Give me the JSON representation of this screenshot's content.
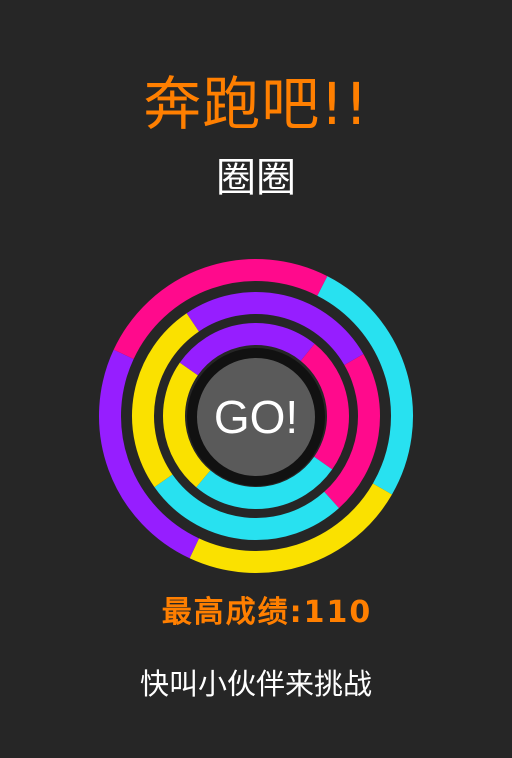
{
  "title": {
    "main": "奔跑吧!!",
    "sub": "圈圈"
  },
  "go_button": {
    "label": "GO!"
  },
  "score": {
    "text": "最高成绩:110"
  },
  "challenge": {
    "text": "快叫小伙伴来挑战"
  },
  "colors": {
    "background": "#262626",
    "accent": "#ff7f00",
    "ring_pink": "#ff0a8c",
    "ring_cyan": "#28e1f0",
    "ring_yellow": "#fae100",
    "ring_purple": "#961eff",
    "go_button_fill": "#5a5a5a",
    "go_button_border": "#111111"
  }
}
